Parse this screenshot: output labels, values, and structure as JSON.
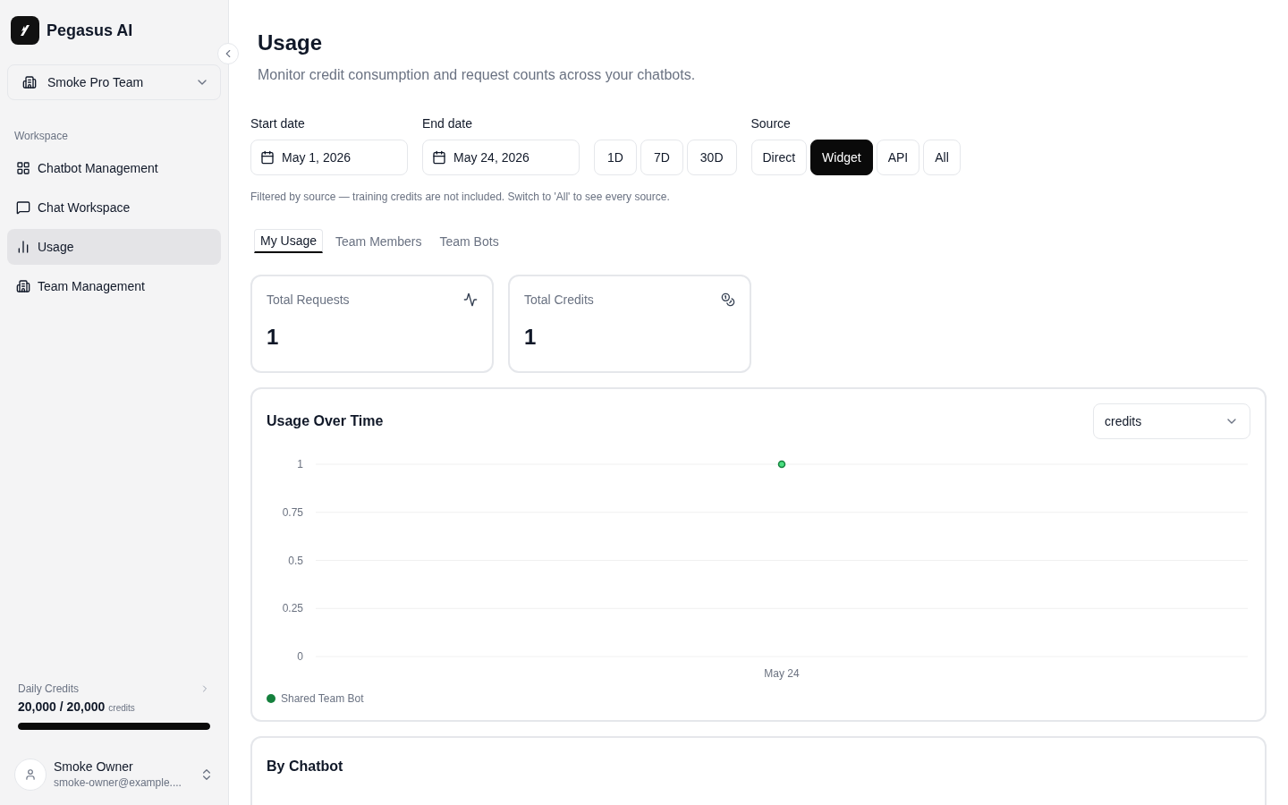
{
  "brand": {
    "name": "Pegasus AI"
  },
  "team_switcher": {
    "label": "Smoke Pro Team"
  },
  "sidebar": {
    "section": "Workspace",
    "items": [
      {
        "label": "Chatbot Management",
        "selected": false
      },
      {
        "label": "Chat Workspace",
        "selected": false
      },
      {
        "label": "Usage",
        "selected": true
      },
      {
        "label": "Team Management",
        "selected": false
      }
    ]
  },
  "daily_credits": {
    "label": "Daily Credits",
    "amount": "20,000 / 20,000",
    "unit": "credits",
    "level": 1
  },
  "user": {
    "name": "Smoke Owner",
    "email": "smoke-owner@example...."
  },
  "page": {
    "title": "Usage",
    "subtitle": "Monitor credit consumption and request counts across your chatbots."
  },
  "filters": {
    "start_label": "Start date",
    "start_value": "May 1, 2026",
    "end_label": "End date",
    "end_value": "May 24, 2026",
    "ranges": [
      "1D",
      "7D",
      "30D"
    ],
    "source_label": "Source",
    "sources": [
      {
        "label": "Direct",
        "selected": false
      },
      {
        "label": "Widget",
        "selected": true
      },
      {
        "label": "API",
        "selected": false
      },
      {
        "label": "All",
        "selected": false
      }
    ],
    "note": "Filtered by source — training credits are not included. Switch to 'All' to see every source."
  },
  "tabs": [
    {
      "label": "My Usage",
      "selected": true
    },
    {
      "label": "Team Members",
      "selected": false
    },
    {
      "label": "Team Bots",
      "selected": false
    }
  ],
  "stats": [
    {
      "label": "Total Requests",
      "value": "1"
    },
    {
      "label": "Total Credits",
      "value": "1"
    }
  ],
  "usage_chart": {
    "title": "Usage Over Time",
    "metric": "credits",
    "chart_data": {
      "type": "line",
      "grid": true,
      "categories": [
        "May 24"
      ],
      "ylim": [
        0,
        1
      ],
      "yticks": [
        0,
        0.25,
        0.5,
        0.75,
        1
      ],
      "series": [
        {
          "name": "Shared Team Bot",
          "color": "#15803d",
          "marker": "circle",
          "values": [
            1
          ]
        }
      ]
    }
  },
  "by_chatbot": {
    "title": "By Chatbot"
  }
}
